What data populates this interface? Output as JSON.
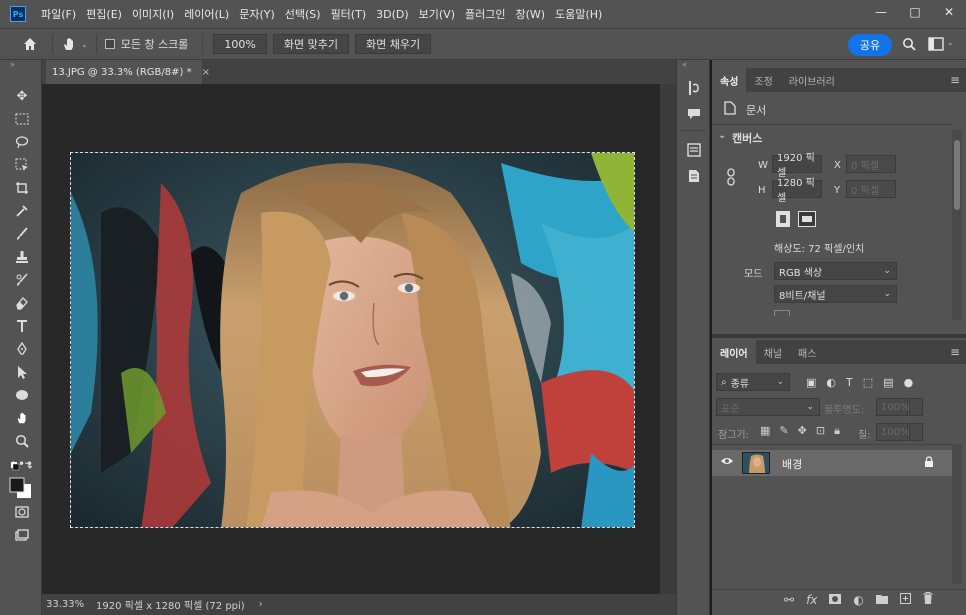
{
  "app": {
    "logo": "Ps"
  },
  "menu": [
    "파일(F)",
    "편집(E)",
    "이미지(I)",
    "레이어(L)",
    "문자(Y)",
    "선택(S)",
    "필터(T)",
    "3D(D)",
    "보기(V)",
    "플러그인",
    "창(W)",
    "도움말(H)"
  ],
  "window_controls": {
    "minimize": "—",
    "maximize": "□",
    "close": "✕"
  },
  "options": {
    "home_icon": "home-icon",
    "hand_icon": "hand-tool-icon",
    "scroll_all_label": "모든 창 스크롤",
    "zoom_value": "100%",
    "fit_screen_label": "화면 맞추기",
    "fill_screen_label": "화면 채우기",
    "share_label": "공유"
  },
  "document": {
    "tab_title": "13.JPG @ 33.3% (RGB/8#) *",
    "tab_close": "×",
    "status_zoom": "33.33%",
    "status_info": "1920 픽셀 x 1280 픽셀 (72 ppi)",
    "status_arrow": "›"
  },
  "properties": {
    "tabs": [
      "속성",
      "조정",
      "라이브러리"
    ],
    "section_doc": "문서",
    "section_canvas": "캔버스",
    "width_label": "W",
    "width_value": "1920 픽셀",
    "height_label": "H",
    "height_value": "1280 픽셀",
    "x_label": "X",
    "x_placeholder": "0 픽셀",
    "y_label": "Y",
    "y_placeholder": "0 픽셀",
    "resolution": "해상도: 72 픽셀/인치",
    "mode_label": "모드",
    "mode_value": "RGB 색상",
    "depth_value": "8비트/채널"
  },
  "layers": {
    "tabs": [
      "레이어",
      "채널",
      "패스"
    ],
    "filter_label": "종류",
    "blend_mode": "표준",
    "opacity_label": "불투명도:",
    "opacity_value": "100%",
    "lock_label": "잠그기:",
    "fill_label": "칠:",
    "fill_value": "100%",
    "items": [
      {
        "name": "배경",
        "visible": true,
        "locked": true
      }
    ],
    "footer_icons": [
      "link-icon",
      "fx-icon",
      "mask-icon",
      "adjustment-icon",
      "group-folder-icon",
      "new-layer-icon",
      "trash-icon"
    ]
  },
  "colors": {
    "accent": "#1473e6",
    "panel": "#535353",
    "canvas_bg": "#282828",
    "selected_layer": "#696969"
  }
}
